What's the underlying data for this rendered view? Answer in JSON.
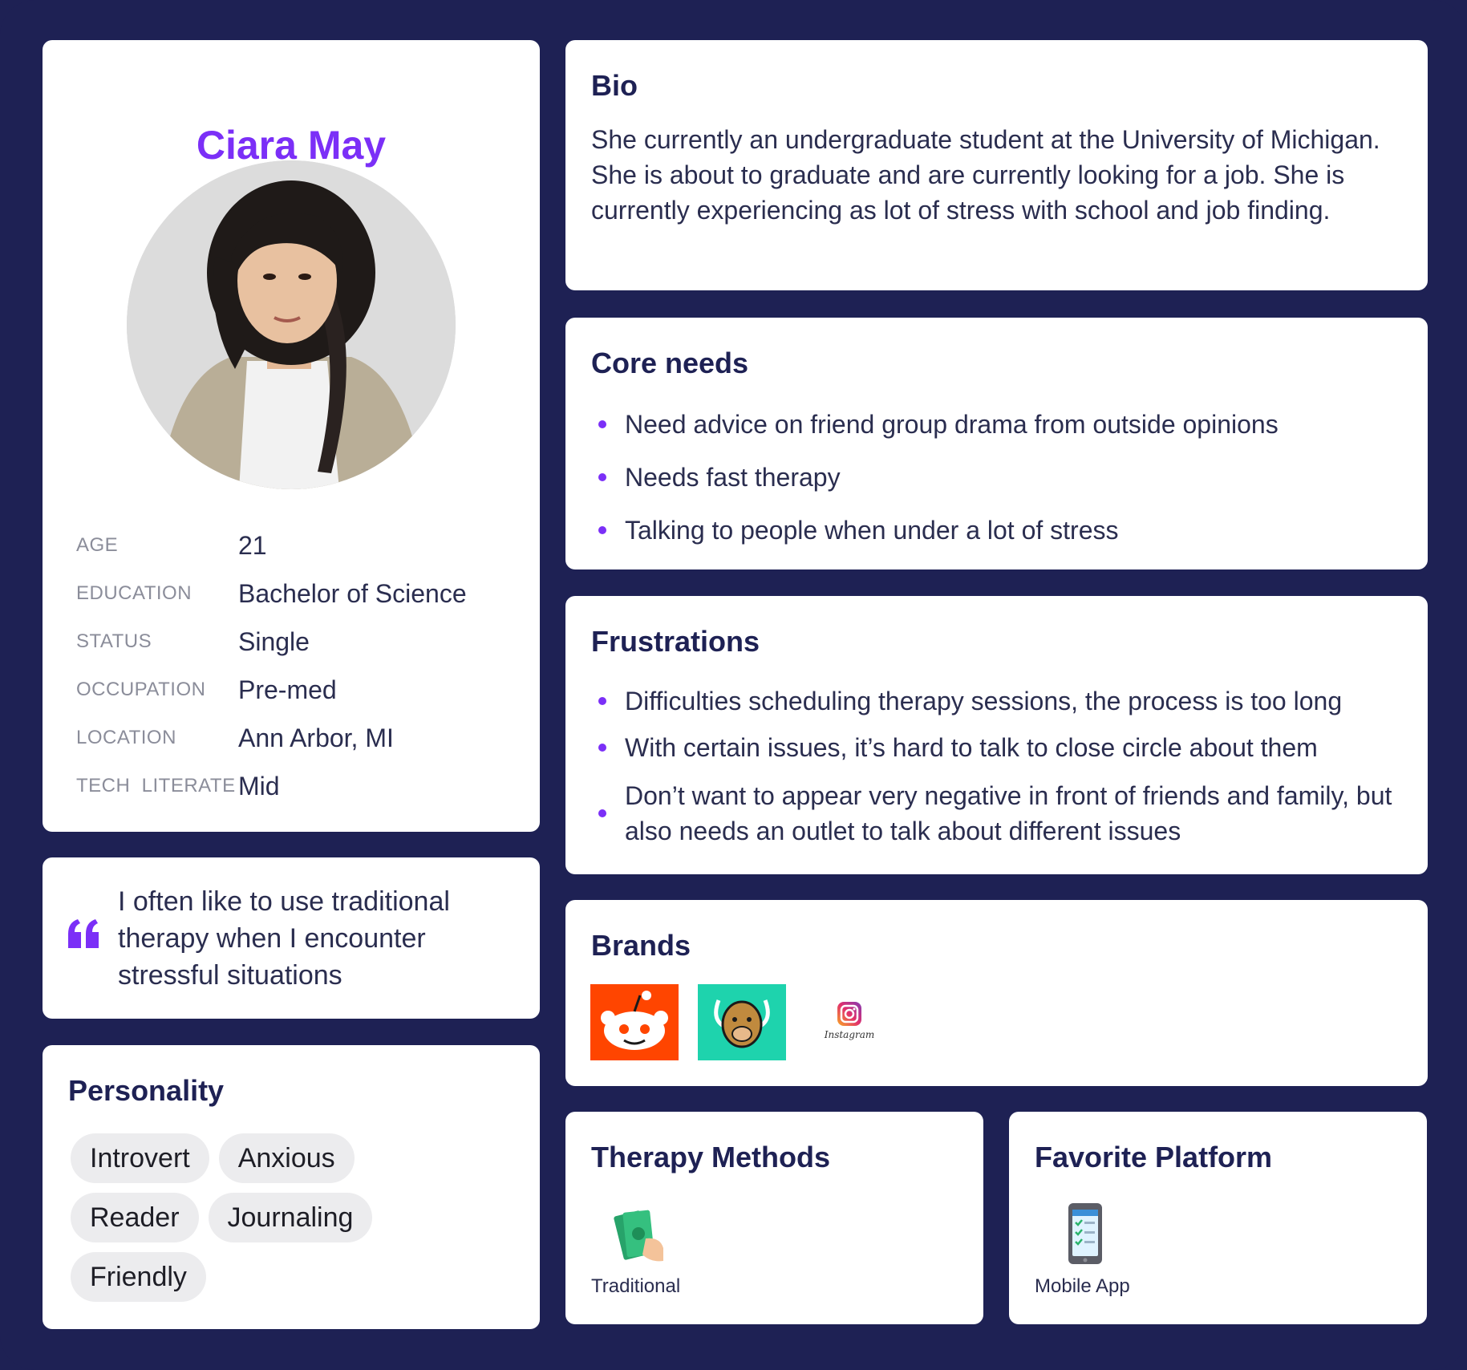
{
  "profile": {
    "name": "Ciara May",
    "facts": [
      {
        "label": "AGE",
        "value": "21"
      },
      {
        "label": "EDUCATION",
        "value": "Bachelor of Science"
      },
      {
        "label": "STATUS",
        "value": "Single"
      },
      {
        "label": "OCCUPATION",
        "value": "Pre-med"
      },
      {
        "label": "LOCATION",
        "value": "Ann Arbor, MI"
      },
      {
        "label": "TECH  LITERATE",
        "value": "Mid"
      }
    ]
  },
  "quote": {
    "text": "I often like to use traditional therapy when I encounter stressful situations"
  },
  "personality": {
    "title": "Personality",
    "tags": [
      "Introvert",
      "Anxious",
      "Reader",
      "Journaling",
      "Friendly"
    ]
  },
  "bio": {
    "title": "Bio",
    "text": "She currently an undergraduate student at the University of Michigan. She is about to graduate and are currently looking for a job. She is currently experiencing as lot of stress with school and job finding."
  },
  "core_needs": {
    "title": "Core needs",
    "items": [
      "Need advice on friend group drama from outside opinions",
      "Needs fast therapy",
      "Talking to people when under a lot of stress"
    ]
  },
  "frustrations": {
    "title": "Frustrations",
    "items": [
      "Difficulties scheduling therapy sessions, the process is too long",
      "With certain issues, it’s hard to talk to close circle about them",
      "Don’t want to appear very negative in front of friends and family, but also needs an outlet to talk about different issues"
    ]
  },
  "brands": {
    "title": "Brands",
    "logos": [
      {
        "icon": "reddit-logo"
      },
      {
        "icon": "yik-yak-logo"
      },
      {
        "icon": "instagram-logo",
        "wordmark": "Instagram"
      }
    ]
  },
  "therapy_methods": {
    "title": "Therapy Methods",
    "icon": "money-hand-icon",
    "label": "Traditional"
  },
  "favorite_platform": {
    "title": "Favorite Platform",
    "icon": "mobile-app-icon",
    "label": "Mobile App"
  },
  "colors": {
    "background": "#1e2154",
    "accent": "#7b2ff7",
    "card": "#ffffff",
    "tag": "#ececee"
  }
}
